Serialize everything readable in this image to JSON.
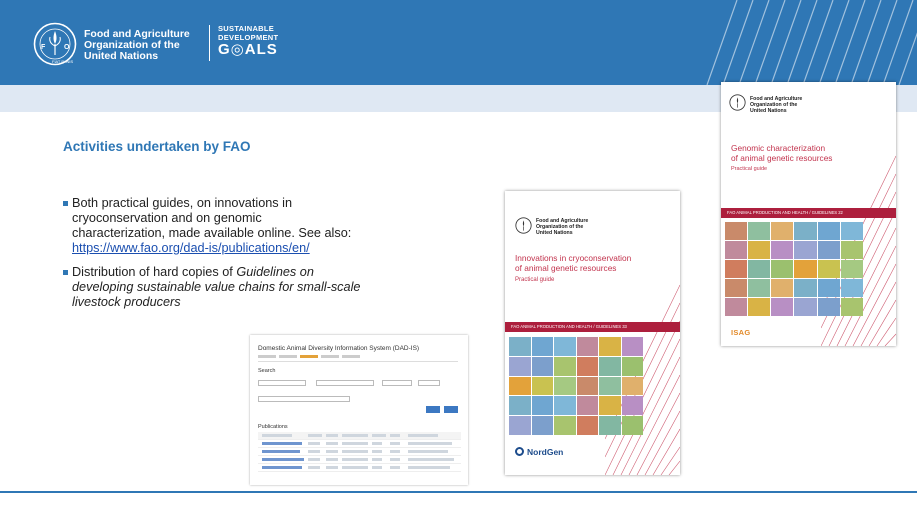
{
  "header": {
    "org_name": [
      "Food and Agriculture",
      "Organization of the",
      "United Nations"
    ],
    "sdg_lines": [
      "SUSTAINABLE",
      "DEVELOPMENT",
      "G◎ALS"
    ],
    "logo_icon": "fao-emblem-icon",
    "colors": {
      "primary": "#2f77b5",
      "subband": "#dfe8f3"
    }
  },
  "slide": {
    "title": "Activities undertaken by FAO",
    "bullets": [
      {
        "lines": [
          "Both practical guides, on innovations in",
          "cryoconservation and on genomic",
          "characterization, made available online. See also:"
        ],
        "link": "https://www.fao.org/dad-is/publications/en/"
      },
      {
        "text_regular": "Distribution of hard copies of ",
        "italic_lines": [
          "Guidelines on",
          "developing sustainable value chains for small-scale",
          "livestock producers"
        ]
      }
    ]
  },
  "dadis": {
    "title": "Domestic Animal Diversity Information System (DAD-IS)",
    "search_heading": "Search",
    "publications_heading": "Publications"
  },
  "book_cryo": {
    "org": [
      "Food and Agriculture",
      "Organization of the",
      "United Nations"
    ],
    "title_lines": [
      "Innovations in cryoconservation",
      "of animal genetic resources"
    ],
    "subtitle": "Practical guide",
    "band": "FAO ANIMAL PRODUCTION AND HEALTH / GUIDELINES 33",
    "publisher": "NordGen",
    "colors": {
      "accent": "#c2334d",
      "band": "#ad1f3d"
    }
  },
  "book_genomic": {
    "org": [
      "Food and Agriculture",
      "Organization of the",
      "United Nations"
    ],
    "title_lines": [
      "Genomic characterization",
      "of animal genetic resources"
    ],
    "subtitle": "Practical guide",
    "band": "FAO ANIMAL PRODUCTION AND HEALTH / GUIDELINES 22",
    "publisher": "ISAG"
  },
  "tile_colors": [
    "#7bb0c8",
    "#9bc06e",
    "#d9b345",
    "#c98a6a",
    "#a8c46e",
    "#6fa6d1",
    "#e3a23a",
    "#b88fc4",
    "#8fbf9f",
    "#d07d5e",
    "#7fb7d8",
    "#c9c250",
    "#9aa5d2",
    "#e0b06c",
    "#82b7a2",
    "#c08a9c",
    "#a5c982",
    "#7c9fcc"
  ]
}
